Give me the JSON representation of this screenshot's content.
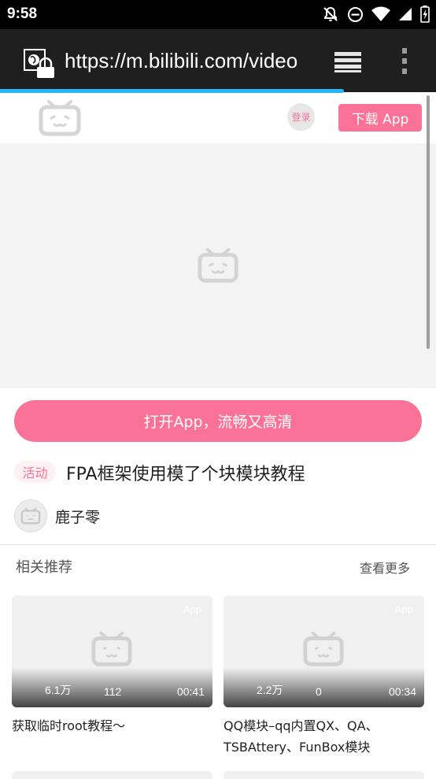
{
  "status_bar": {
    "time": "9:58"
  },
  "browser": {
    "url": "https://m.bilibili.com/video"
  },
  "header": {
    "login_label": "登录",
    "download_label": "下载 App"
  },
  "open_app_label": "打开App，流畅又高清",
  "video": {
    "tag": "活动",
    "title": "FPA框架使用模了个块模块教程",
    "author": "鹿子零"
  },
  "related": {
    "section_title": "相关推荐",
    "see_more": "查看更多",
    "cards": [
      {
        "app_label": "App",
        "views": "6.1万",
        "danmaku": "112",
        "duration": "00:41",
        "title": "获取临时root教程～"
      },
      {
        "app_label": "App",
        "views": "2.2万",
        "danmaku": "0",
        "duration": "00:34",
        "title": "QQ模块–qq内置QX、QA、TSBAttery、FunBox模块"
      }
    ]
  },
  "colors": {
    "brand_pink": "#fb7299",
    "progress_blue": "#29b6f6"
  }
}
